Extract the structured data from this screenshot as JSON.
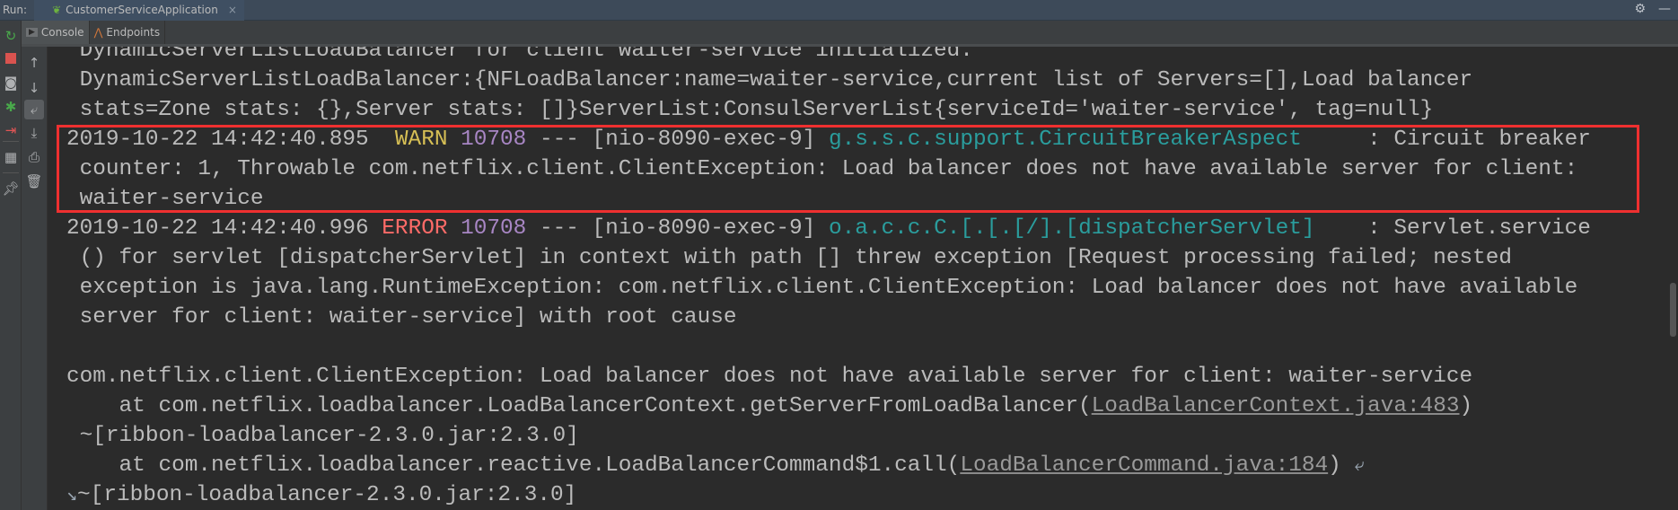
{
  "topbar": {
    "run_label": "Run:",
    "run_tab": "CustomerServiceApplication",
    "close_glyph": "×",
    "settings_icon": "gear-icon",
    "minimize_icon": "minimize-icon"
  },
  "tabs": [
    {
      "label": "Console",
      "icon": "console-icon",
      "active": true
    },
    {
      "label": "Endpoints",
      "icon": "endpoints-icon",
      "active": false
    }
  ],
  "toolbar_left": [
    "rerun-icon",
    "stop-icon",
    "camera-icon",
    "debug-icon",
    "exit-icon",
    "layout-icon",
    "pin-icon"
  ],
  "toolbar_console": [
    "up-arrow-icon",
    "down-arrow-icon",
    "soft-wrap-icon",
    "scroll-to-end-icon",
    "print-icon",
    "trash-icon"
  ],
  "colors": {
    "background": "#2b2b2b",
    "text": "#bbbbbb",
    "warn": "#d6bf55",
    "error": "#ff6b68",
    "pid": "#a886c4",
    "logger": "#2a9d9d",
    "highlight_box": "#ef3030"
  },
  "console": {
    "lines": [
      [
        {
          "t": " DynamicServerListLoadBalancer for client waiter-service initialized."
        }
      ],
      [
        {
          "t": " DynamicServerListLoadBalancer:{NFLoadBalancer:name=waiter-service,current list of Servers=[],Load balancer"
        }
      ],
      [
        {
          "t": " stats=Zone stats: {},Server stats: []}ServerList:ConsulServerList{serviceId='waiter-service', tag=null}"
        }
      ],
      [
        {
          "t": "2019-10-22 14:42:40.895  "
        },
        {
          "t": "WARN",
          "c": "warn"
        },
        {
          "t": " "
        },
        {
          "t": "10708",
          "c": "pid"
        },
        {
          "t": " --- [nio-8090-exec-9] "
        },
        {
          "t": "g.s.s.c.support.CircuitBreakerAspect",
          "c": "logger"
        },
        {
          "t": "     : Circuit breaker"
        }
      ],
      [
        {
          "t": " counter: 1, Throwable com.netflix.client.ClientException: Load balancer does not have available server for client:"
        }
      ],
      [
        {
          "t": " waiter-service"
        }
      ],
      [
        {
          "t": "2019-10-22 14:42:40.996 "
        },
        {
          "t": "ERROR",
          "c": "error"
        },
        {
          "t": " "
        },
        {
          "t": "10708",
          "c": "pid"
        },
        {
          "t": " --- [nio-8090-exec-9] "
        },
        {
          "t": "o.a.c.c.C.[.[.[/].[dispatcherServlet]",
          "c": "logger"
        },
        {
          "t": "    : Servlet.service"
        }
      ],
      [
        {
          "t": " () for servlet [dispatcherServlet] in context with path [] threw exception [Request processing failed; nested"
        }
      ],
      [
        {
          "t": " exception is java.lang.RuntimeException: com.netflix.client.ClientException: Load balancer does not have available"
        }
      ],
      [
        {
          "t": " server for client: waiter-service] with root cause"
        }
      ],
      [
        {
          "t": ""
        }
      ],
      [
        {
          "t": "com.netflix.client.ClientException: Load balancer does not have available server for client: waiter-service"
        }
      ],
      [
        {
          "t": "    at com.netflix.loadbalancer.LoadBalancerContext.getServerFromLoadBalancer("
        },
        {
          "t": "LoadBalancerContext.java:483",
          "c": "link"
        },
        {
          "t": ")"
        }
      ],
      [
        {
          "t": " ~[ribbon-loadbalancer-2.3.0.jar:2.3.0]"
        }
      ],
      [
        {
          "t": "    at com.netflix.loadbalancer.reactive.LoadBalancerCommand$1.call("
        },
        {
          "t": "LoadBalancerCommand.java:184",
          "c": "link"
        },
        {
          "t": ") "
        },
        {
          "t": "⤶",
          "c": "wrapic",
          "icon": "soft-wrap-end-icon"
        }
      ],
      [
        {
          "t": "↘",
          "c": "wrapic",
          "icon": "soft-wrap-start-icon"
        },
        {
          "t": "~[ribbon-loadbalancer-2.3.0.jar:2.3.0]"
        }
      ]
    ]
  }
}
